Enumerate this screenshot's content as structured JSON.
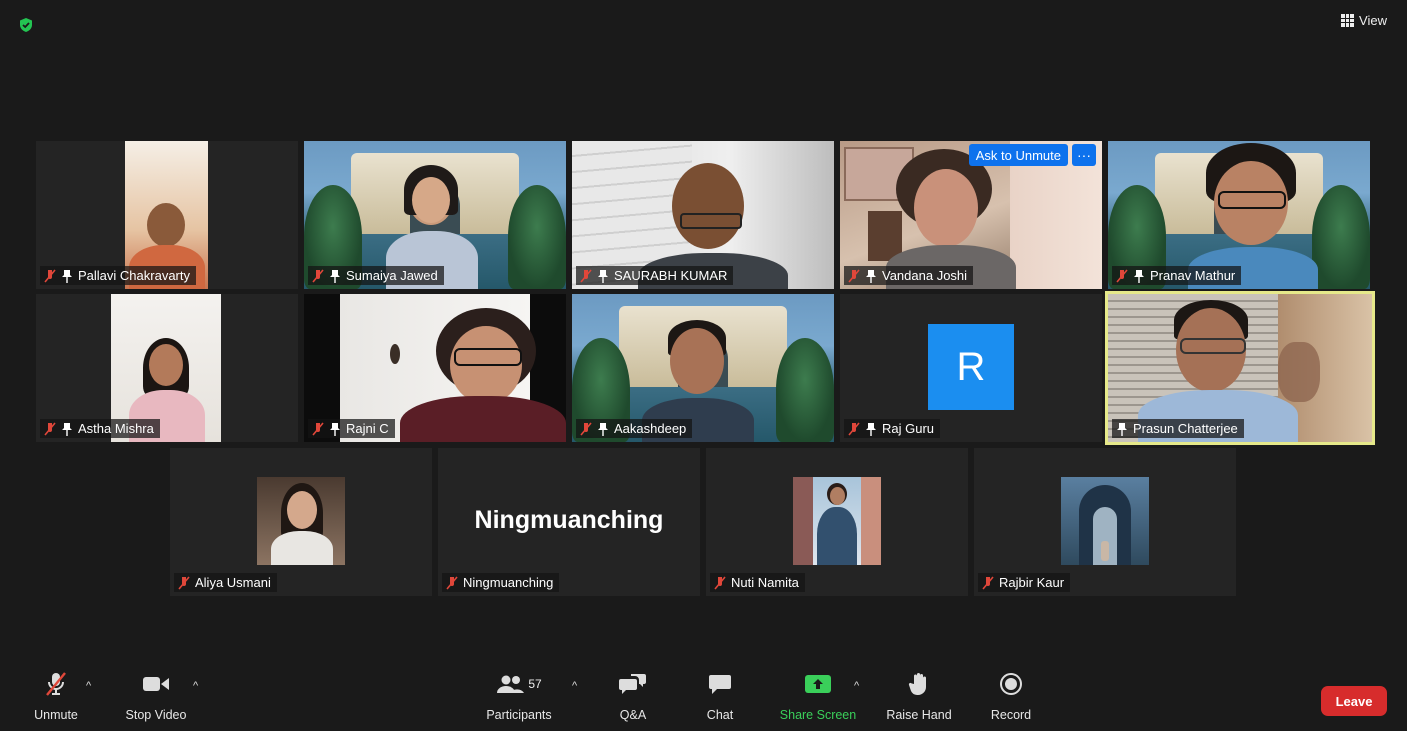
{
  "top_bar": {
    "view_label": "View"
  },
  "participants": [
    {
      "name": "Pallavi Chakravarty"
    },
    {
      "name": "Sumaiya Jawed"
    },
    {
      "name": "SAURABH KUMAR"
    },
    {
      "name": "Vandana Joshi",
      "ask_to_unmute_label": "Ask to Unmute",
      "more_label": "···"
    },
    {
      "name": "Pranav Mathur"
    },
    {
      "name": "Astha Mishra"
    },
    {
      "name": "Rajni C"
    },
    {
      "name": "Aakashdeep"
    },
    {
      "name": "Raj Guru",
      "avatar_letter": "R"
    },
    {
      "name": "Prasun Chatterjee",
      "active_speaker": true
    },
    {
      "name": "Aliya Usmani"
    },
    {
      "name": "Ningmuanching",
      "display_name_large": "Ningmuanching"
    },
    {
      "name": "Nuti Namita"
    },
    {
      "name": "Rajbir Kaur"
    }
  ],
  "toolbar": {
    "unmute_label": "Unmute",
    "stop_video_label": "Stop Video",
    "participants_label": "Participants",
    "participants_count": "57",
    "qa_label": "Q&A",
    "chat_label": "Chat",
    "share_screen_label": "Share Screen",
    "raise_hand_label": "Raise Hand",
    "record_label": "Record",
    "leave_label": "Leave",
    "caret": "^"
  },
  "colors": {
    "background": "#1a1a1a",
    "tile": "#242424",
    "accent_blue": "#0e72ed",
    "share_green": "#3acf5a",
    "leave_red": "#d72c2c",
    "active_border": "#e6e98a",
    "mute_red": "#e0473a"
  }
}
